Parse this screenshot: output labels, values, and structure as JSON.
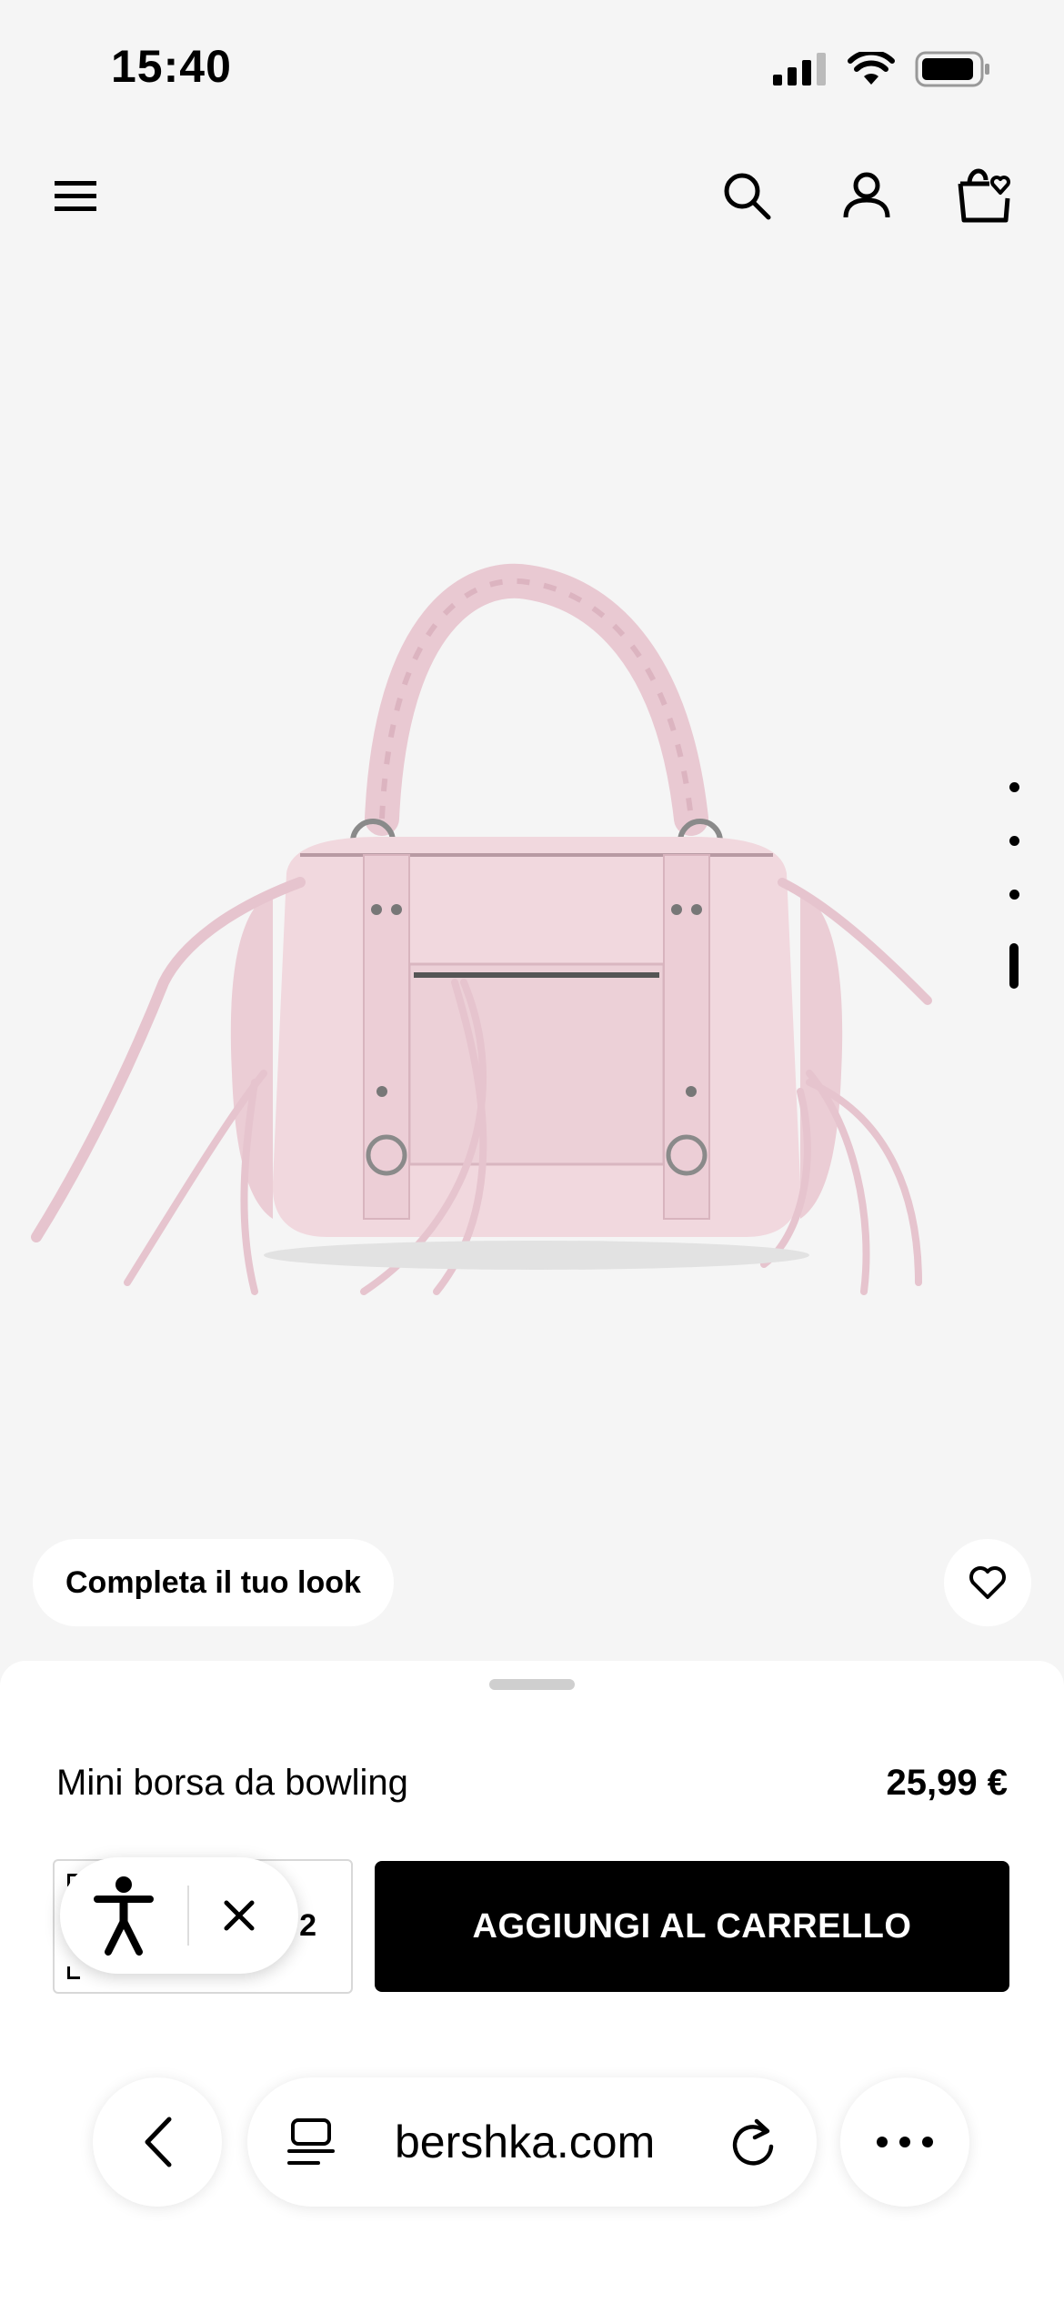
{
  "status_bar": {
    "time": "15:40"
  },
  "header": {
    "menu_icon": "hamburger-menu-icon",
    "search_icon": "search-icon",
    "account_icon": "user-icon",
    "bag_icon": "shopping-bag-heart-icon"
  },
  "gallery": {
    "image_alt": "Mini borsa da bowling rosa",
    "dots_count": 4,
    "active_index": 3
  },
  "look_pill": {
    "label": "Completa il tuo look"
  },
  "product": {
    "name": "Mini borsa da bowling",
    "price": "25,99 €",
    "size_value": "2"
  },
  "actions": {
    "add_to_cart": "AGGIUNGI AL CARRELLO"
  },
  "browser": {
    "url": "bershka.com"
  },
  "colors": {
    "accent": "#000000",
    "background": "#f5f5f5",
    "bag": "#f1d8de"
  }
}
